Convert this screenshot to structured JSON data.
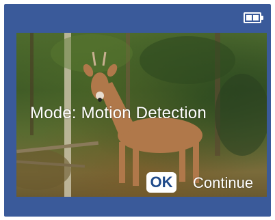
{
  "status": {
    "battery_icon": "battery-icon"
  },
  "preview": {
    "subject": "deer-in-forest"
  },
  "overlay": {
    "mode_text": "Mode: Motion Detection",
    "ok_label": "OK",
    "continue_label": "Continue"
  },
  "colors": {
    "frame": "#3a5a9a",
    "ok_text": "#1f4a8a"
  }
}
